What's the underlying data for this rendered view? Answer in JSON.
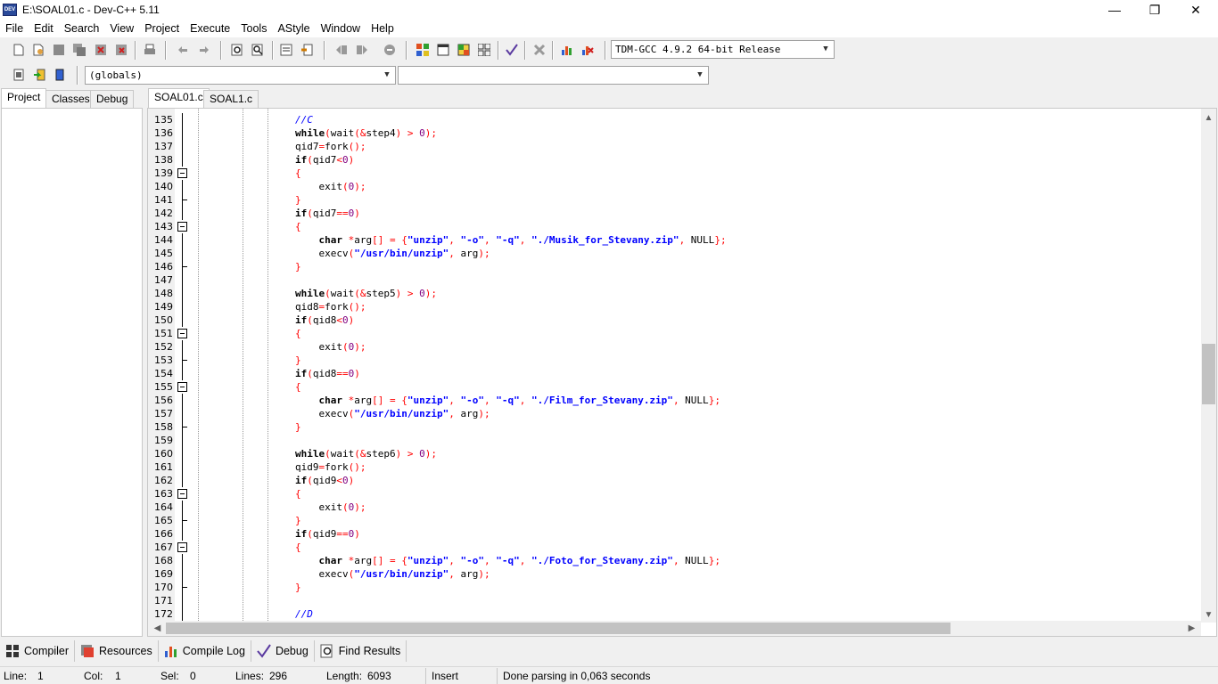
{
  "window": {
    "title": "E:\\SOAL01.c - Dev-C++ 5.11",
    "app_icon_label": "DEV",
    "minimize": "—",
    "maximize": "❐",
    "close": "✕"
  },
  "menu": [
    "File",
    "Edit",
    "Search",
    "View",
    "Project",
    "Execute",
    "Tools",
    "AStyle",
    "Window",
    "Help"
  ],
  "toolbar": {
    "compiler_select": "TDM-GCC 4.9.2 64-bit Release",
    "scope_select": "(globals)",
    "member_select": ""
  },
  "left_tabs": [
    "Project",
    "Classes",
    "Debug"
  ],
  "editor_tabs": [
    "SOAL01.c",
    "SOAL1.c"
  ],
  "code": {
    "line_numbers": [
      "135",
      "136",
      "137",
      "138",
      "139",
      "140",
      "141",
      "142",
      "143",
      "144",
      "145",
      "146",
      "147",
      "148",
      "149",
      "150",
      "151",
      "152",
      "153",
      "154",
      "155",
      "156",
      "157",
      "158",
      "159",
      "160",
      "161",
      "162",
      "163",
      "164",
      "165",
      "166",
      "167",
      "168",
      "169",
      "170",
      "171",
      "172"
    ],
    "fold_lines": [
      "139",
      "143",
      "151",
      "155",
      "163",
      "167"
    ],
    "lines": [
      "//C",
      "while(wait(&step4) > 0);",
      "qid7=fork();",
      "if(qid7<0)",
      "{",
      "    exit(0);",
      "}",
      "if(qid7==0)",
      "{",
      "    char *arg[] = {\"unzip\", \"-o\", \"-q\", \"./Musik_for_Stevany.zip\", NULL};",
      "    execv(\"/usr/bin/unzip\", arg);",
      "}",
      "",
      "while(wait(&step5) > 0);",
      "qid8=fork();",
      "if(qid8<0)",
      "{",
      "    exit(0);",
      "}",
      "if(qid8==0)",
      "{",
      "    char *arg[] = {\"unzip\", \"-o\", \"-q\", \"./Film_for_Stevany.zip\", NULL};",
      "    execv(\"/usr/bin/unzip\", arg);",
      "}",
      "",
      "while(wait(&step6) > 0);",
      "qid9=fork();",
      "if(qid9<0)",
      "{",
      "    exit(0);",
      "}",
      "if(qid9==0)",
      "{",
      "    char *arg[] = {\"unzip\", \"-o\", \"-q\", \"./Foto_for_Stevany.zip\", NULL};",
      "    execv(\"/usr/bin/unzip\", arg);",
      "}",
      "",
      "//D"
    ]
  },
  "bottom_tabs": [
    "Compiler",
    "Resources",
    "Compile Log",
    "Debug",
    "Find Results"
  ],
  "status": {
    "line_label": "Line:",
    "line_value": "1",
    "col_label": "Col:",
    "col_value": "1",
    "sel_label": "Sel:",
    "sel_value": "0",
    "lines_label": "Lines:",
    "lines_value": "296",
    "length_label": "Length:",
    "length_value": "6093",
    "mode": "Insert",
    "message": "Done parsing in 0,063 seconds"
  },
  "icons": [
    "new-file-icon",
    "open-icon",
    "save-icon",
    "save-all-icon",
    "close-icon",
    "close-all-icon",
    "print-icon",
    "undo-icon",
    "redo-icon",
    "find-icon",
    "replace-icon",
    "goto-icon",
    "indent-icon",
    "unindent-icon",
    "toggle-comment-icon",
    "compile-icon",
    "run-icon",
    "compile-run-icon",
    "rebuild-icon",
    "syntax-check-icon",
    "stop-icon",
    "profile-icon",
    "delete-profile-icon"
  ]
}
